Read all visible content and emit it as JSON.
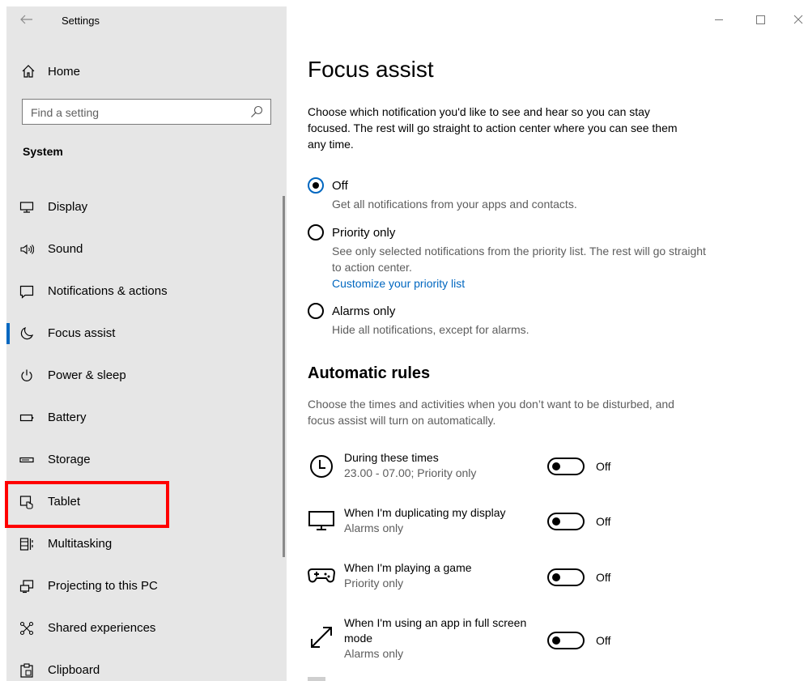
{
  "window": {
    "title": "Settings"
  },
  "sidebar": {
    "home_label": "Home",
    "search_placeholder": "Find a setting",
    "section": "System",
    "items": [
      {
        "label": "Display",
        "icon": "monitor-icon"
      },
      {
        "label": "Sound",
        "icon": "speaker-icon"
      },
      {
        "label": "Notifications & actions",
        "icon": "notification-icon"
      },
      {
        "label": "Focus assist",
        "icon": "moon-icon",
        "selected": true
      },
      {
        "label": "Power & sleep",
        "icon": "power-icon"
      },
      {
        "label": "Battery",
        "icon": "battery-icon"
      },
      {
        "label": "Storage",
        "icon": "storage-icon"
      },
      {
        "label": "Tablet",
        "icon": "tablet-icon"
      },
      {
        "label": "Multitasking",
        "icon": "multitasking-icon"
      },
      {
        "label": "Projecting to this PC",
        "icon": "projecting-icon"
      },
      {
        "label": "Shared experiences",
        "icon": "shared-icon"
      },
      {
        "label": "Clipboard",
        "icon": "clipboard-icon"
      }
    ]
  },
  "main": {
    "title": "Focus assist",
    "description": "Choose which notification you'd like to see and hear so you can stay focused. The rest will go straight to action center where you can see them any time.",
    "options": [
      {
        "label": "Off",
        "description": "Get all notifications from your apps and contacts.",
        "selected": true
      },
      {
        "label": "Priority only",
        "description": "See only selected notifications from the priority list. The rest will go straight to action center.",
        "link": "Customize your priority list",
        "selected": false
      },
      {
        "label": "Alarms only",
        "description": "Hide all notifications, except for alarms.",
        "selected": false
      }
    ],
    "rules_title": "Automatic rules",
    "rules_description": "Choose the times and activities when you don’t want to be disturbed, and focus assist will turn on automatically.",
    "rules": [
      {
        "name": "During these times",
        "detail": "23.00 - 07.00; Priority only",
        "state": "Off",
        "icon": "clock-icon"
      },
      {
        "name": "When I'm duplicating my display",
        "detail": "Alarms only",
        "state": "Off",
        "icon": "monitor-icon"
      },
      {
        "name": "When I'm playing a game",
        "detail": "Priority only",
        "state": "Off",
        "icon": "gamepad-icon"
      },
      {
        "name": "When I'm using an app in full screen mode",
        "detail": "Alarms only",
        "state": "Off",
        "icon": "fullscreen-icon"
      }
    ]
  },
  "colors": {
    "sidebar_bg": "#e6e6e6",
    "accent": "#0067c0",
    "highlight": "#ff0000"
  }
}
